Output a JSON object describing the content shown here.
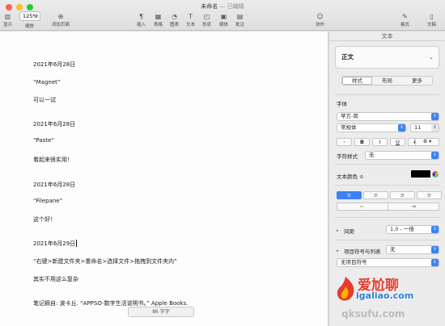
{
  "window": {
    "title": "未命名",
    "subtitle": "— 已编辑"
  },
  "toolbar": {
    "zoom_value": "125%",
    "view_label": "显示",
    "zoom_label": "缩放",
    "add_page_label": "添加页面",
    "insert_label": "插入",
    "table_label": "表格",
    "chart_label": "图表",
    "text_label": "文本",
    "shape_label": "形状",
    "media_label": "媒体",
    "comment_label": "批注",
    "collab_label": "协作",
    "format_label": "格式",
    "document_label": "文稿"
  },
  "document": {
    "lines": [
      "2021年6月28日",
      "“Magnet”",
      "可以一试",
      "2021年6月28日",
      "“Paste”",
      "看起来很实用！",
      "2021年6月28日",
      "“Filepane”",
      "这个好！",
      "2021年6月29日",
      "“右键>新建文件夹>重命名>选择文件>拖拽到文件夹内”",
      "其实不用这么复杂",
      "笔记摘自: 波卡丘. “APPSO-数字生活说明书。” Apple Books."
    ],
    "word_count": "86 字字"
  },
  "panel": {
    "header": "文本",
    "paragraph_style": "正文",
    "tabs": [
      "样式",
      "布局",
      "更多"
    ],
    "active_tab": "样式",
    "font_section": "字体",
    "font_family": "苹方-简",
    "font_weight": "常规体",
    "font_size": "11",
    "bold": "B",
    "italic": "I",
    "underline": "U",
    "strike": "S",
    "char_style_label": "字符样式",
    "char_style_value": "无",
    "text_color_label": "文本颜色 ≎",
    "text_color": "#000000",
    "spacing_label": "间距",
    "spacing_value": "1.0 - 一倍",
    "bullets_label": "项目符号与列表",
    "bullets_value": "无",
    "bullets_sub": "无项目符号"
  },
  "watermark": {
    "brand": "爱尬聊",
    "url": "igaliao.com",
    "url2": "qksufu.com"
  },
  "colors": {
    "accent": "#3b82f6",
    "brand_red": "#e53b30",
    "brand_blue": "#2f7fd8"
  }
}
